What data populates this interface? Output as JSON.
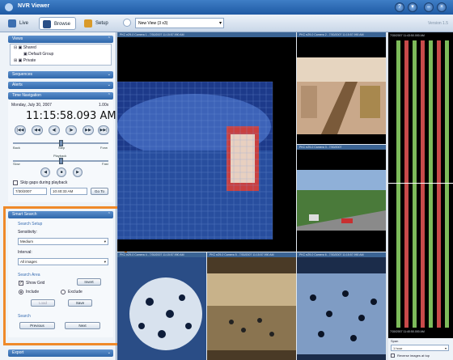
{
  "app": {
    "title": "NVR Viewer",
    "version": "Version 1.5"
  },
  "tabs": [
    {
      "label": "Live",
      "icon": "eye-icon"
    },
    {
      "label": "Browse",
      "icon": "binoculars-icon"
    },
    {
      "label": "Setup",
      "icon": "wrench-icon"
    }
  ],
  "view_selector": {
    "value": "New View (3 x3)"
  },
  "sidebar": {
    "views": {
      "header": "Views",
      "tree": [
        "Shared",
        "Default Group",
        "Private"
      ]
    },
    "panels": [
      "Sequences",
      "Alerts"
    ],
    "time_navigation": {
      "header": "Time Navigation",
      "date": "Monday, July 30, 2007",
      "speed": "1.00x",
      "clock": "11:15:58.093 AM",
      "step_labels": {
        "back": "Back",
        "step": "Step",
        "forward": "Forw"
      },
      "playback_label": "Playback",
      "slow": "Slow",
      "fast": "Fast",
      "skip_gaps": "Skip gaps during playback",
      "goto_date": "7/30/2007",
      "goto_time": "10:40:33 AM",
      "goto_button": "Go To"
    },
    "smart_search": {
      "header": "Smart Search",
      "setup_label": "Search Setup",
      "sensitivity_label": "Sensitivity:",
      "sensitivity_value": "Medium",
      "interval_label": "Interval:",
      "interval_value": "All images",
      "area_label": "Search Area",
      "show_grid": "Show Grid",
      "invert": "Invert",
      "include": "Include",
      "exclude": "Exclude",
      "load": "Load",
      "save": "Save",
      "search_label": "Search",
      "previous": "Previous",
      "next": "Next"
    },
    "export_header": "Export"
  },
  "cameras": [
    {
      "name": "PKC eZ9-0 Camera 1 - 7/30/2007 11:15:57.990 AM",
      "scene": "mall-grid",
      "colors": [
        "#1d3a8a",
        "#5b7fd0"
      ]
    },
    {
      "name": "PKC eZ9-0 Camera 2 - 7/30/2007 11:15:57.990 AM",
      "scene": "escalator",
      "colors": [
        "#c9a88a",
        "#7a5a3a"
      ]
    },
    {
      "name": "PKC eZ9-0 Camera 3 - 7/30/2007",
      "scene": "street",
      "colors": [
        "#6e8fbf",
        "#4a7a3a"
      ]
    },
    {
      "name": "PKC eZ9-0 Camera 4 - 7/30/2007 11:15:57.990 AM",
      "scene": "crowd-blue",
      "colors": [
        "#2a4d86",
        "#0e1d3a"
      ]
    },
    {
      "name": "PKC eZ9-0 Camera 5 - 7/30/2007 11:15:57.990 AM",
      "scene": "mall-hall",
      "colors": [
        "#c8b28a",
        "#4a3a26"
      ]
    },
    {
      "name": "PKC eZ9-0 Camera 6 - 7/30/2007 11:15:57.990 AM",
      "scene": "crowd-floor",
      "colors": [
        "#7f9cc4",
        "#1b2c4a"
      ]
    }
  ],
  "timeline": {
    "top_stamp": "7/30/2007 11:43:50.000 AM",
    "bottom_stamp": "7/30/2007 11:40:50.000 AM",
    "bar_colors": [
      "#7dbb5a",
      "#c84a4a",
      "#7dbb5a",
      "#c84a4a",
      "#7dbb5a",
      "#c84a4a",
      "#7dbb5a"
    ]
  },
  "span": {
    "label": "Span",
    "value": "1 hour",
    "reverse": "Reverse images at top"
  }
}
